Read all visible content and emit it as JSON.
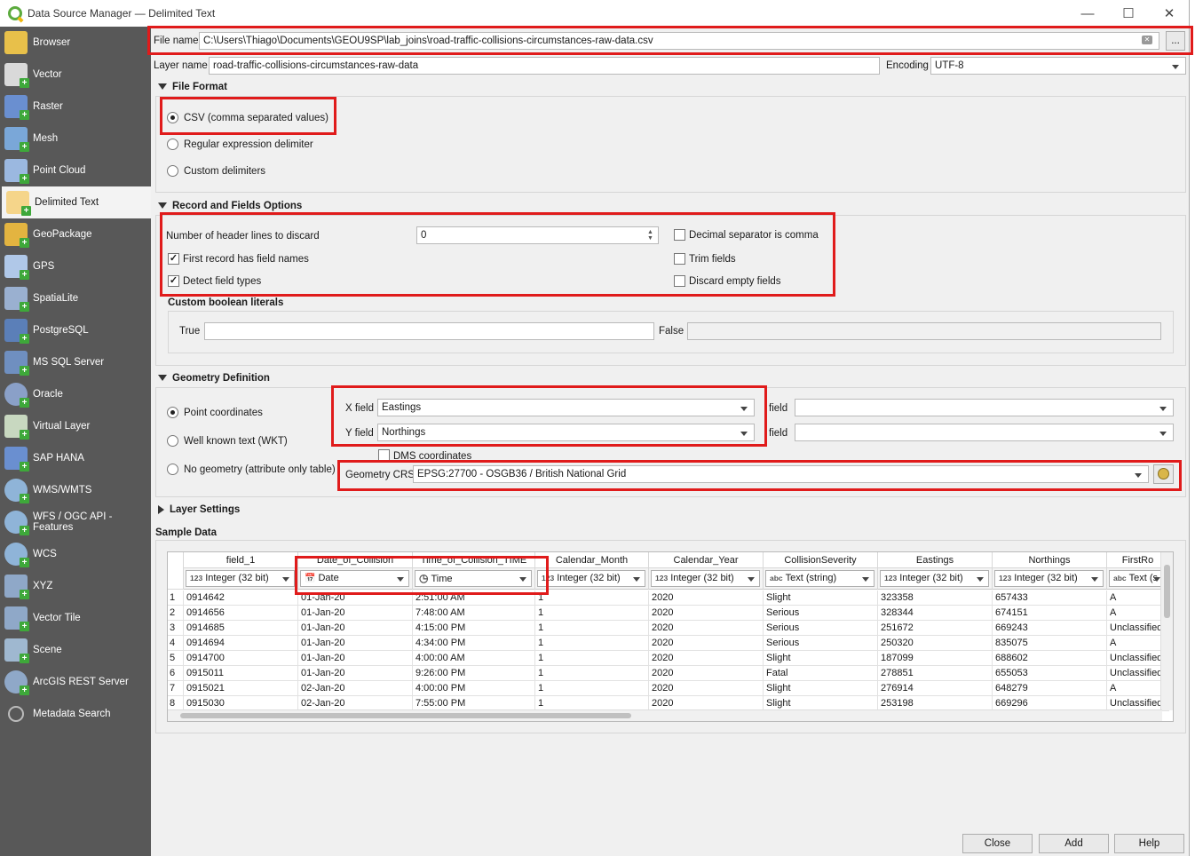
{
  "window": {
    "title": "Data Source Manager — Delimited Text"
  },
  "sidebar": {
    "items": [
      {
        "label": "Browser",
        "icon": "folder-icon"
      },
      {
        "label": "Vector",
        "icon": "vector-icon"
      },
      {
        "label": "Raster",
        "icon": "raster-icon"
      },
      {
        "label": "Mesh",
        "icon": "mesh-icon"
      },
      {
        "label": "Point Cloud",
        "icon": "point-cloud-icon"
      },
      {
        "label": "Delimited Text",
        "icon": "delimited-text-icon"
      },
      {
        "label": "GeoPackage",
        "icon": "geopackage-icon"
      },
      {
        "label": "GPS",
        "icon": "gps-icon"
      },
      {
        "label": "SpatiaLite",
        "icon": "spatialite-icon"
      },
      {
        "label": "PostgreSQL",
        "icon": "postgresql-icon"
      },
      {
        "label": "MS SQL Server",
        "icon": "mssql-icon"
      },
      {
        "label": "Oracle",
        "icon": "oracle-icon"
      },
      {
        "label": "Virtual Layer",
        "icon": "virtual-layer-icon"
      },
      {
        "label": "SAP HANA",
        "icon": "sap-hana-icon"
      },
      {
        "label": "WMS/WMTS",
        "icon": "wms-icon"
      },
      {
        "label": "WFS / OGC API - Features",
        "icon": "wfs-icon"
      },
      {
        "label": "WCS",
        "icon": "wcs-icon"
      },
      {
        "label": "XYZ",
        "icon": "xyz-icon"
      },
      {
        "label": "Vector Tile",
        "icon": "vector-tile-icon"
      },
      {
        "label": "Scene",
        "icon": "scene-icon"
      },
      {
        "label": "ArcGIS REST Server",
        "icon": "arcgis-icon"
      },
      {
        "label": "Metadata Search",
        "icon": "search-icon"
      }
    ]
  },
  "file": {
    "name_label": "File name",
    "name_value": "C:\\Users\\Thiago\\Documents\\GEOU9SP\\lab_joins\\road-traffic-collisions-circumstances-raw-data.csv",
    "browse_label": "...",
    "layer_label": "Layer name",
    "layer_value": "road-traffic-collisions-circumstances-raw-data",
    "encoding_label": "Encoding",
    "encoding_value": "UTF-8"
  },
  "file_format": {
    "heading": "File Format",
    "csv": "CSV (comma separated values)",
    "regex": "Regular expression delimiter",
    "custom": "Custom delimiters"
  },
  "record": {
    "heading": "Record and Fields Options",
    "header_lines_label": "Number of header lines to discard",
    "header_lines_value": "0",
    "first_record": "First record has field names",
    "detect_types": "Detect field types",
    "decimal_comma": "Decimal separator is comma",
    "trim": "Trim fields",
    "discard_empty": "Discard empty fields",
    "bool_heading": "Custom boolean literals",
    "true_label": "True",
    "false_label": "False"
  },
  "geometry": {
    "heading": "Geometry Definition",
    "point": "Point coordinates",
    "wkt": "Well known text (WKT)",
    "none": "No geometry (attribute only table)",
    "x_label": "X field",
    "x_value": "Eastings",
    "y_label": "Y field",
    "y_value": "Northings",
    "z_label": "field",
    "m_label": "field",
    "dms": "DMS coordinates",
    "crs_label": "Geometry CRS",
    "crs_value": "EPSG:27700 - OSGB36 / British National Grid"
  },
  "layer_settings": {
    "heading": "Layer Settings"
  },
  "sample": {
    "heading": "Sample Data",
    "columns": [
      {
        "name": "field_1",
        "type": "Integer (32 bit)",
        "tag": "123"
      },
      {
        "name": "Date_of_Collision",
        "type": "Date",
        "tag": "cal"
      },
      {
        "name": "Time_of_Collision_TIME",
        "type": "Time",
        "tag": "clock"
      },
      {
        "name": "Calendar_Month",
        "type": "Integer (32 bit)",
        "tag": "123"
      },
      {
        "name": "Calendar_Year",
        "type": "Integer (32 bit)",
        "tag": "123"
      },
      {
        "name": "CollisionSeverity",
        "type": "Text (string)",
        "tag": "abc"
      },
      {
        "name": "Eastings",
        "type": "Integer (32 bit)",
        "tag": "123"
      },
      {
        "name": "Northings",
        "type": "Integer (32 bit)",
        "tag": "123"
      },
      {
        "name": "FirstRo",
        "type": "Text (s",
        "tag": "abc"
      }
    ],
    "rows": [
      [
        "1",
        "0914642",
        "01-Jan-20",
        "2:51:00 AM",
        "1",
        "2020",
        "Slight",
        "323358",
        "657433",
        "A"
      ],
      [
        "2",
        "0914656",
        "01-Jan-20",
        "7:48:00 AM",
        "1",
        "2020",
        "Serious",
        "328344",
        "674151",
        "A"
      ],
      [
        "3",
        "0914685",
        "01-Jan-20",
        "4:15:00 PM",
        "1",
        "2020",
        "Serious",
        "251672",
        "669243",
        "Unclassified"
      ],
      [
        "4",
        "0914694",
        "01-Jan-20",
        "4:34:00 PM",
        "1",
        "2020",
        "Serious",
        "250320",
        "835075",
        "A"
      ],
      [
        "5",
        "0914700",
        "01-Jan-20",
        "4:00:00 AM",
        "1",
        "2020",
        "Slight",
        "187099",
        "688602",
        "Unclassified"
      ],
      [
        "6",
        "0915011",
        "01-Jan-20",
        "9:26:00 PM",
        "1",
        "2020",
        "Fatal",
        "278851",
        "655053",
        "Unclassified"
      ],
      [
        "7",
        "0915021",
        "02-Jan-20",
        "4:00:00 PM",
        "1",
        "2020",
        "Slight",
        "276914",
        "648279",
        "A"
      ],
      [
        "8",
        "0915030",
        "02-Jan-20",
        "7:55:00 PM",
        "1",
        "2020",
        "Slight",
        "253198",
        "669296",
        "Unclassified"
      ]
    ]
  },
  "buttons": {
    "close": "Close",
    "add": "Add",
    "help": "Help"
  },
  "colors": {
    "sidebar": "#585858",
    "highlight": "#e01b1b",
    "plus": "#3ea83a"
  }
}
